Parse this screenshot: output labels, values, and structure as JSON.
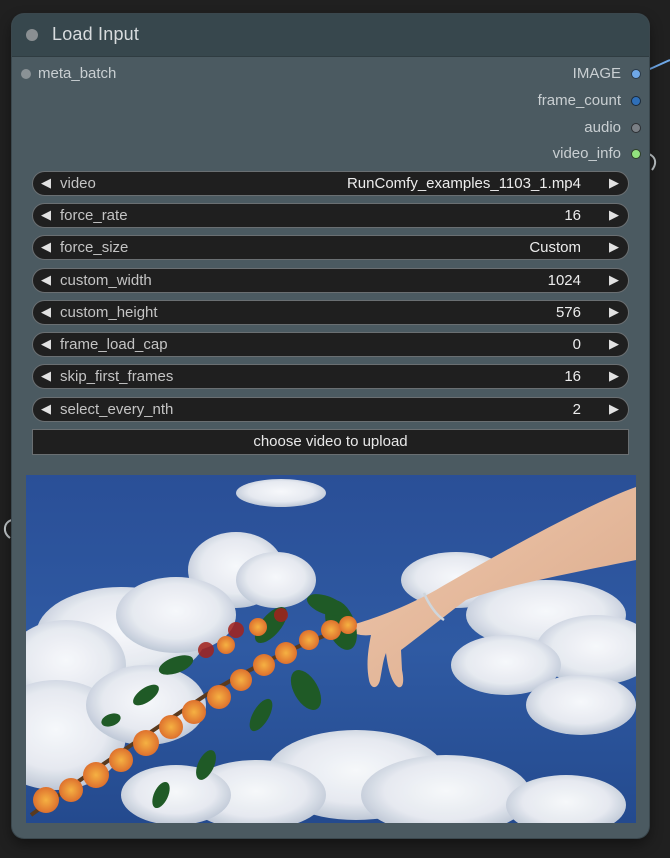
{
  "node": {
    "title": "Load Input"
  },
  "inputs": [
    {
      "label": "meta_batch"
    }
  ],
  "outputs": [
    {
      "label": "IMAGE",
      "color": "#6fa8e8"
    },
    {
      "label": "frame_count",
      "color": "#2f6fb8"
    },
    {
      "label": "audio",
      "color": "#7a7f85"
    },
    {
      "label": "video_info",
      "color": "#92e27e"
    }
  ],
  "widgets": [
    {
      "name": "video",
      "value": "RunComfy_examples_1103_1.mp4"
    },
    {
      "name": "force_rate",
      "value": "16"
    },
    {
      "name": "force_size",
      "value": "Custom"
    },
    {
      "name": "custom_width",
      "value": "1024"
    },
    {
      "name": "custom_height",
      "value": "576"
    },
    {
      "name": "frame_load_cap",
      "value": "0"
    },
    {
      "name": "skip_first_frames",
      "value": "16"
    },
    {
      "name": "select_every_nth",
      "value": "2"
    }
  ],
  "upload_button": {
    "label": "choose video to upload"
  },
  "icons": {
    "left_arrow": "◀",
    "right_arrow": "▶"
  },
  "colors": {
    "node_body": "#4b5a61",
    "node_header": "#37474d",
    "widget_bg": "#1f1f1f",
    "canvas_bg": "#202020"
  }
}
